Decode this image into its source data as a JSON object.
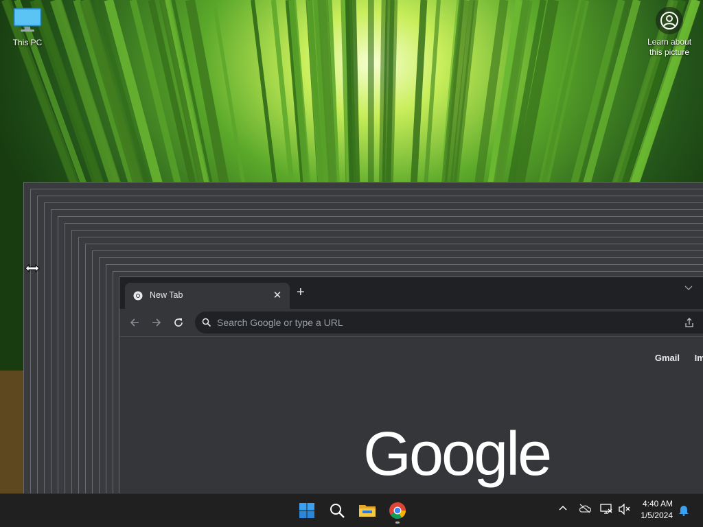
{
  "desktop": {
    "icons": [
      {
        "label": "This PC",
        "icon": "monitor-icon"
      }
    ],
    "spotlight": {
      "label_line1": "Learn about",
      "label_line2": "this picture",
      "icon": "spotlight-camera-icon"
    }
  },
  "browser": {
    "tab": {
      "title": "New Tab",
      "favicon": "chrome-icon",
      "close_glyph": "✕"
    },
    "new_tab_glyph": "+",
    "omnibox": {
      "placeholder": "Search Google or type a URL"
    },
    "ntp_links": [
      "Gmail",
      "Ima"
    ],
    "logo_text": "Google"
  },
  "taskbar": {
    "apps": [
      {
        "name": "Start",
        "icon": "windows-start-icon"
      },
      {
        "name": "Search",
        "icon": "search-icon"
      },
      {
        "name": "File Explorer",
        "icon": "folder-icon"
      },
      {
        "name": "Google Chrome",
        "icon": "chrome-icon",
        "active": true
      }
    ],
    "tray": [
      "chevron-up-icon",
      "onedrive-icon",
      "network-icon",
      "volume-muted-icon"
    ],
    "clock": {
      "time": "4:40 AM",
      "date": "1/5/2024"
    },
    "notification_icon": "bell-icon"
  },
  "colors": {
    "taskbar_bg": "#202020",
    "browser_frame": "#202124",
    "browser_surface": "#35363a",
    "omnibox_bg": "#202124"
  }
}
